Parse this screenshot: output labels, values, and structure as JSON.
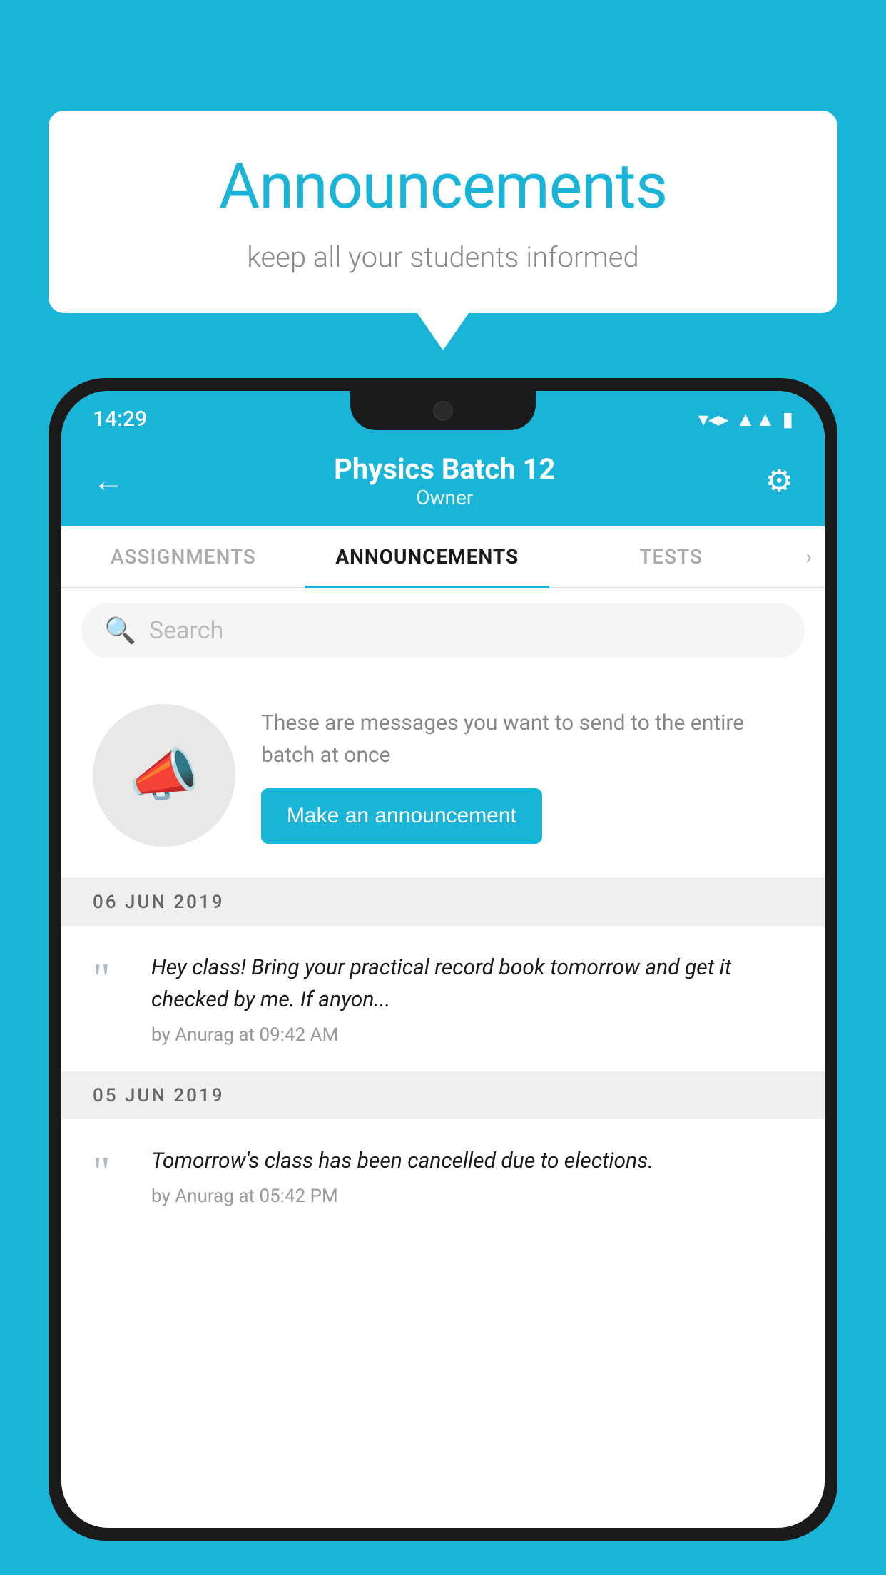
{
  "background_color": "#1ab4d8",
  "speech_bubble": {
    "title": "Announcements",
    "subtitle": "keep all your students informed"
  },
  "phone": {
    "status_bar": {
      "time": "14:29",
      "wifi": "▾",
      "signal": "▴",
      "battery": "▮"
    },
    "header": {
      "back_label": "←",
      "title": "Physics Batch 12",
      "subtitle": "Owner",
      "gear_label": "⚙"
    },
    "tabs": [
      {
        "label": "ASSIGNMENTS",
        "active": false
      },
      {
        "label": "ANNOUNCEMENTS",
        "active": true
      },
      {
        "label": "TESTS",
        "active": false
      },
      {
        "label": "›",
        "active": false
      }
    ],
    "search": {
      "placeholder": "Search"
    },
    "promo": {
      "message": "These are messages you want to send to the entire batch at once",
      "button_label": "Make an announcement"
    },
    "announcements": [
      {
        "date": "06  JUN  2019",
        "text": "Hey class! Bring your practical record book tomorrow and get it checked by me. If anyon...",
        "meta": "by Anurag at 09:42 AM"
      },
      {
        "date": "05  JUN  2019",
        "text": "Tomorrow's class has been cancelled due to elections.",
        "meta": "by Anurag at 05:42 PM"
      }
    ]
  }
}
